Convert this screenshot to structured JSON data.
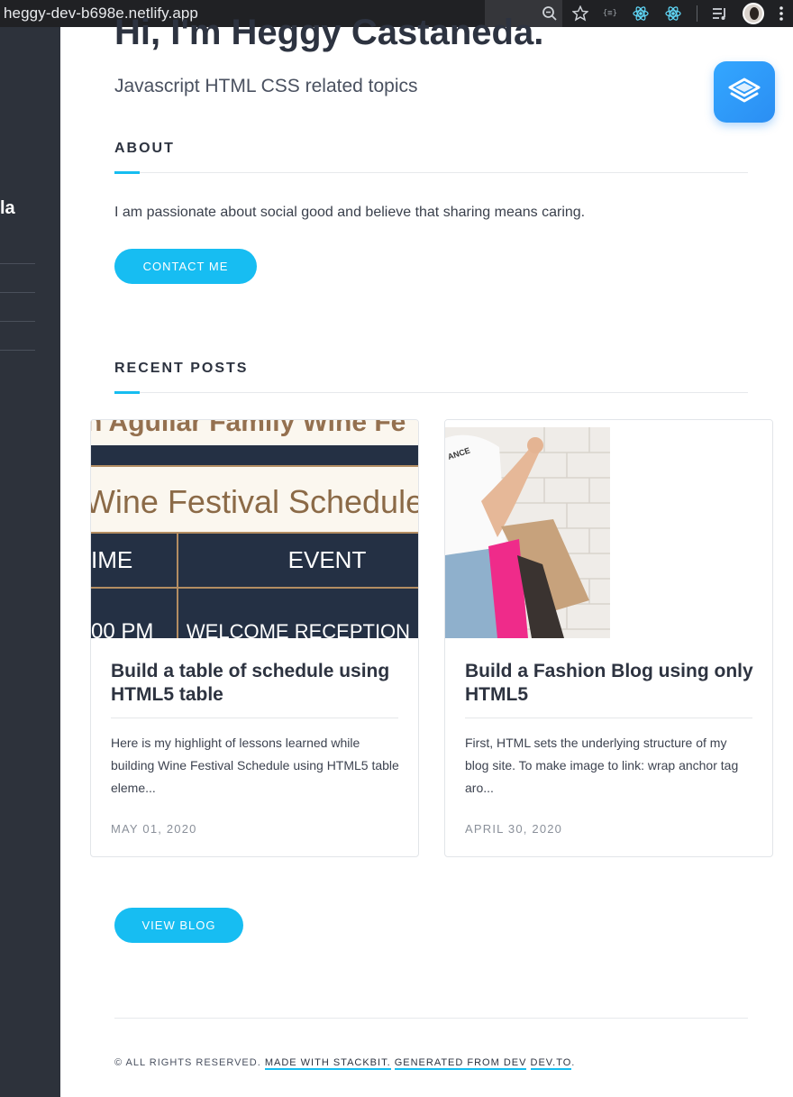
{
  "browser": {
    "url": "heggy-dev-b698e.netlify.app",
    "icons": [
      "zoom-icon",
      "star-icon",
      "extension-icon",
      "react-devtools-icon",
      "react-devtools-icon",
      "media-control-icon",
      "profile-avatar",
      "menu-kebab-icon"
    ]
  },
  "sidebar": {
    "name_fragment": "la"
  },
  "hero": {
    "title": "Hi, I'm Heggy Castaneda.",
    "tagline": "Javascript HTML CSS related topics"
  },
  "about": {
    "heading": "ABOUT",
    "text": "I am passionate about social good and believe that sharing means caring.",
    "button": "CONTACT ME"
  },
  "recent_posts": {
    "heading": "RECENT POSTS",
    "posts": [
      {
        "title": "Build a table of schedule using HTML5 table",
        "excerpt": "Here is my highlight of lessons learned while building Wine Festival Schedule using HTML5 table eleme...",
        "date": "MAY 01, 2020",
        "image": {
          "top_text": "n Aguilar Family Wine Fe",
          "heading": "Wine Festival Schedule",
          "col1": "IME",
          "col2": "EVENT",
          "row1": "00 PM",
          "row2": "WELCOME RECEPTION"
        }
      },
      {
        "title": "Build a Fashion Blog using only HTML5",
        "excerpt": "First, HTML sets the underlying structure of my blog site. To make image to link: wrap anchor tag aro...",
        "date": "APRIL 30, 2020",
        "image": {
          "shirt_text": "ANCE"
        }
      }
    ],
    "button": "VIEW BLOG"
  },
  "footer": {
    "rights": "© ALL RIGHTS RESERVED.",
    "made_with": "MADE WITH STACKBIT.",
    "generated": "GENERATED FROM DEV",
    "devto": "DEV.TO",
    "end": "."
  },
  "colors": {
    "accent": "#17bdf2",
    "sidebar": "#2d323b",
    "text": "#2d3340"
  }
}
